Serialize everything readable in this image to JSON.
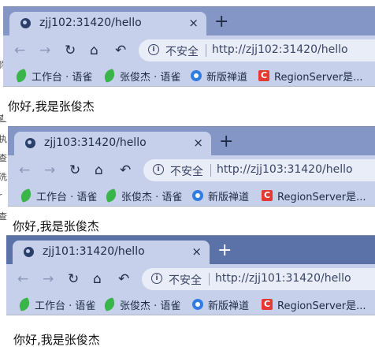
{
  "left_strip_chars": [
    "你",
    "查",
    "执",
    "查",
    "洗",
    "r",
    "查"
  ],
  "windows": [
    {
      "tab_title": "zjj102:31420/hello",
      "insecure_label": "不安全",
      "url": "http://zjj102:31420/hello",
      "page_text": "你好,我是张俊杰",
      "bookmarks": [
        "工作台 · 语雀",
        "张俊杰 · 语雀",
        "新版禅道",
        "RegionServer是..."
      ]
    },
    {
      "tab_title": "zjj103:31420/hello",
      "insecure_label": "不安全",
      "url": "http://zjj103:31420/hello",
      "page_text": "你好,我是张俊杰",
      "bookmarks": [
        "工作台 · 语雀",
        "张俊杰 · 语雀",
        "新版禅道",
        "RegionServer是..."
      ]
    },
    {
      "tab_title": "zjj101:31420/hello",
      "insecure_label": "不安全",
      "url": "http://zjj101:31420/hello",
      "page_text": "你好,我是张俊杰",
      "bookmarks": [
        "工作台 · 语雀",
        "张俊杰 · 语雀",
        "新版禅道",
        "RegionServer是..."
      ]
    }
  ],
  "icons": {
    "tab_close": "×",
    "new_tab": "+",
    "back": "←",
    "forward": "→",
    "reload": "↻",
    "home": "⌂",
    "undo": "↶"
  },
  "colors": {
    "tabbar": "#8396c6",
    "tabbar_focused": "#5a72a8",
    "toolbar": "#c6d0ea",
    "yuque_green": "#3ab54a",
    "chandao_blue": "#2f7de1",
    "regionserver_red": "#e53935"
  }
}
